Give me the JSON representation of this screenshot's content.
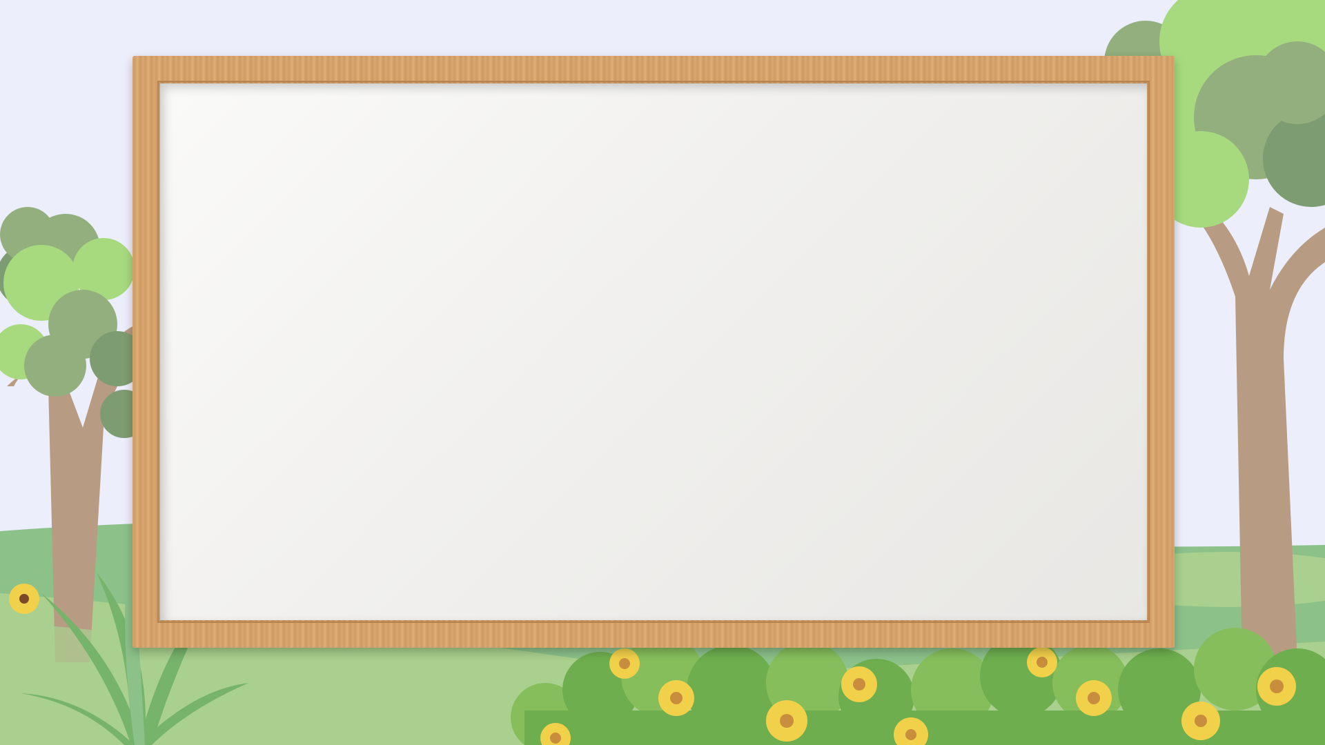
{
  "scene": {
    "title": "",
    "colors": {
      "sky": "#ECEEFB",
      "grass_light": "#A9D08E",
      "grass_mid": "#8CC18A",
      "grass_dark": "#76B36B",
      "leaf_light": "#A7DA7F",
      "leaf_mid": "#93AF7E",
      "leaf_dark": "#7E9C72",
      "trunk": "#B89B83",
      "bush": "#6EAE4E",
      "bush_light": "#86BE5C",
      "flower_petal": "#F2D14A",
      "flower_center": "#C98E3D",
      "frame_wood": "#D8A56F",
      "board": "#F3F2F0"
    },
    "icons": [
      "tree-left-icon",
      "tree-right-icon",
      "bush-icon",
      "flower-icon",
      "grass-tuft-icon"
    ]
  },
  "whiteboard": {
    "text": ""
  }
}
